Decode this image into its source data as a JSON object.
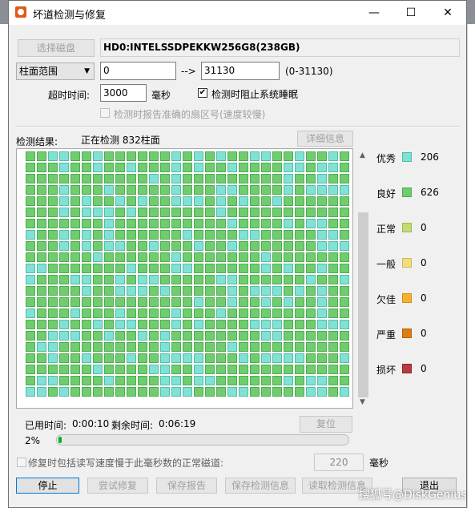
{
  "window": {
    "title": "坏道检测与修复",
    "minimize": "—",
    "maximize": "☐",
    "close": "✕"
  },
  "disk": {
    "select_button": "选择磁盘",
    "name": "HD0:INTELSSDPEKKW256G8(238GB)"
  },
  "range": {
    "mode": "柱面范围",
    "start": "0",
    "arrow": "-->",
    "end": "31130",
    "hint": "(0-31130)"
  },
  "timeout": {
    "label": "超时时间:",
    "value": "3000",
    "unit": "毫秒"
  },
  "prevent_sleep": {
    "label": "检测时阻止系统睡眠",
    "checked": true
  },
  "report_sector": {
    "label": "检测时报告准确的扇区号(速度较慢)",
    "checked": false
  },
  "result": {
    "label": "检测结果:",
    "status": "正在检测 832柱面",
    "detail_button": "详细信息"
  },
  "grid": {
    "columns": 29,
    "rows": 22,
    "checked_cells": 832
  },
  "legend": [
    {
      "label": "优秀",
      "value": "206",
      "color": "#7fe3d4",
      "border": "#4db8a8"
    },
    {
      "label": "良好",
      "value": "626",
      "color": "#6fcd6f",
      "border": "#4fab4f"
    },
    {
      "label": "正常",
      "value": "0",
      "color": "#c2dc72",
      "border": "#9cb84d"
    },
    {
      "label": "一般",
      "value": "0",
      "color": "#f2dd7e",
      "border": "#cfb858"
    },
    {
      "label": "欠佳",
      "value": "0",
      "color": "#f6b02f",
      "border": "#d08e15"
    },
    {
      "label": "严重",
      "value": "0",
      "color": "#dc7d12",
      "border": "#b3620a"
    },
    {
      "label": "损坏",
      "value": "0",
      "color": "#b93a3f",
      "border": "#8f2328"
    }
  ],
  "time": {
    "elapsed_label": "已用时间:",
    "elapsed": "0:00:10",
    "remaining_label": "剩余时间:",
    "remaining": "0:06:19",
    "reset_button": "复位"
  },
  "progress": {
    "text": "2%",
    "value": 0.02
  },
  "repair_option": {
    "label": "修复时包括读写速度慢于此毫秒数的正常磁道:",
    "value": "220",
    "unit": "毫秒"
  },
  "buttons": {
    "stop": "停止",
    "try_repair": "尝试修复",
    "save_report": "保存报告",
    "save_info": "保存检测信息",
    "read_info": "读取检测信息",
    "exit": "退出"
  },
  "watermark": "搜狐号@DiskGenius"
}
